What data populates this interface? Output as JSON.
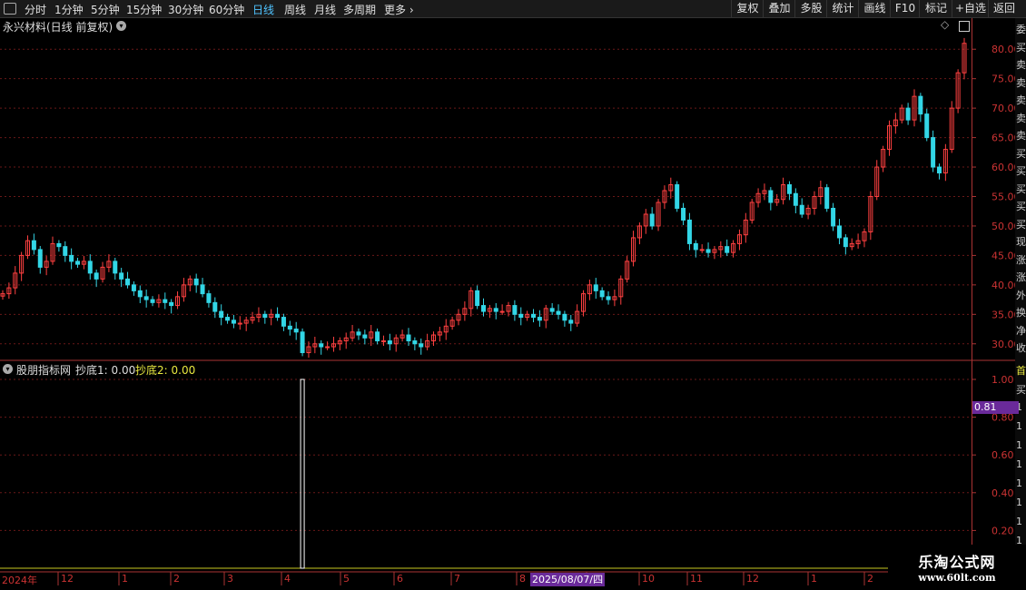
{
  "toolbar": {
    "periods": [
      {
        "label": "分时",
        "active": false
      },
      {
        "label": "1分钟",
        "active": false
      },
      {
        "label": "5分钟",
        "active": false
      },
      {
        "label": "15分钟",
        "active": false
      },
      {
        "label": "30分钟",
        "active": false
      },
      {
        "label": "60分钟",
        "active": false
      },
      {
        "label": "日线",
        "active": true
      },
      {
        "label": "周线",
        "active": false
      },
      {
        "label": "月线",
        "active": false
      },
      {
        "label": "多周期",
        "active": false
      },
      {
        "label": "更多",
        "active": false
      }
    ],
    "actions": [
      "复权",
      "叠加",
      "多股",
      "统计",
      "画线",
      "F10",
      "标记",
      "+自选",
      "返回"
    ]
  },
  "chart": {
    "title": "永兴材料(日线 前复权)",
    "indicator_name": "股朋指标网",
    "indicator_value1": "抄底1: 0.00",
    "indicator_value2": "抄底2: 0.00",
    "price_tag": "0.81",
    "date_tag": "2025/08/07/四",
    "far_right_chars": [
      "委",
      "买",
      "卖",
      "卖",
      "卖",
      "卖",
      "卖",
      "买",
      "买",
      "买",
      "买",
      "买",
      "现",
      "涨",
      "涨",
      "外",
      "换",
      "净",
      "收"
    ],
    "far_right_chars2": [
      "首",
      "买",
      "1",
      "1",
      "1",
      "1",
      "1",
      "1",
      "1",
      "1"
    ]
  },
  "chart_data": [
    {
      "type": "candlestick",
      "title": "永兴材料(日线 前复权)",
      "y_ticks": [
        "80.00",
        "75.00",
        "70.00",
        "65.00",
        "60.00",
        "55.00",
        "50.00",
        "45.00",
        "40.00",
        "35.00",
        "30.00"
      ],
      "ylim": [
        27.5,
        82.5
      ],
      "x_ticks": [
        "2024年",
        "12",
        "1",
        "2",
        "3",
        "4",
        "5",
        "6",
        "7",
        "8",
        "9",
        "10",
        "11",
        "12",
        "1",
        "2"
      ],
      "up_color": "#ff4040",
      "down_color": "#33d6e6",
      "close_approx": [
        38.5,
        39.5,
        42,
        45,
        47.5,
        46,
        43,
        44,
        47,
        46.5,
        45,
        44,
        43.5,
        44,
        42,
        41,
        43,
        44,
        42,
        41,
        40,
        39,
        38,
        37.5,
        37,
        37.5,
        37,
        36.5,
        38,
        40,
        41,
        40,
        38.5,
        37,
        35.5,
        34.5,
        34,
        33.5,
        33.5,
        34,
        34.5,
        35,
        34.5,
        35,
        34.5,
        33,
        32.5,
        32,
        28.5,
        29.5,
        30,
        29.5,
        29.5,
        30,
        30.5,
        31,
        32,
        31.5,
        31,
        32,
        30.5,
        30.5,
        30,
        31,
        31.5,
        30.5,
        30,
        29.5,
        30.5,
        31.5,
        32,
        33,
        34,
        35,
        36,
        39,
        36.5,
        35.5,
        36,
        35.5,
        35.5,
        36.5,
        35,
        34.5,
        35,
        34.5,
        34,
        36,
        35.5,
        35,
        34,
        33.5,
        35.5,
        38.5,
        40,
        39,
        38,
        37.5,
        38,
        41,
        44,
        48,
        50,
        52,
        50,
        54,
        56,
        57,
        53,
        51,
        47,
        46,
        46,
        45.5,
        46,
        46.5,
        45.5,
        47,
        48.5,
        51,
        54,
        55.5,
        56,
        54,
        54.5,
        57,
        55.5,
        53.5,
        52,
        53,
        55,
        56.5,
        53,
        50,
        48,
        46.5,
        47,
        47.5,
        49,
        55,
        60,
        63,
        67,
        68,
        70,
        68,
        72,
        69,
        65,
        60,
        59,
        63,
        70,
        76,
        81
      ],
      "series": [
        {
          "name": "抄底1",
          "value": "0.00"
        },
        {
          "name": "抄底2",
          "value": "0.00"
        }
      ]
    },
    {
      "type": "bar",
      "title": "股朋指标网",
      "y_ticks": [
        "1.00",
        "0.80",
        "0.60",
        "0.40",
        "0.20"
      ],
      "ylim": [
        0,
        1
      ],
      "spikes": [
        {
          "x_index": 48,
          "value": 1.0
        }
      ]
    }
  ],
  "watermark": {
    "line1": "乐淘公式网",
    "line2": "www.60lt.com"
  }
}
